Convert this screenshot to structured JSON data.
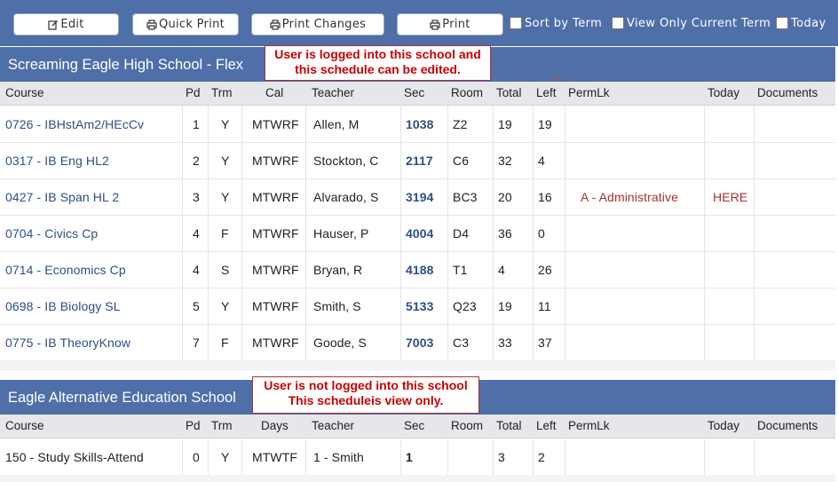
{
  "toolbar": {
    "edit_label": "Edit",
    "quick_print_label": "Quick Print",
    "print_changes_label": "Print Changes",
    "print_label": "Print",
    "sort_by_term_label": "Sort by Term",
    "view_only_current_term_label": "View Only Current Term",
    "today_label": "Today"
  },
  "colors": {
    "header_blue": "#4f6fa8",
    "link_blue": "#2e4f8a",
    "notice_red": "#cc0000",
    "perm_red": "#a83232"
  },
  "schools": [
    {
      "name": "Screaming Eagle High School - Flex",
      "notice_line1": "User is logged into this school and",
      "notice_line2": "this schedule can be edited.",
      "columns": [
        "Course",
        "Pd",
        "Trm",
        "Cal",
        "Teacher",
        "Sec",
        "Room",
        "Total",
        "Left",
        "PermLk",
        "Today",
        "Documents"
      ],
      "rows": [
        {
          "course": "0726 - IBHstAm2/HEcCv",
          "pd": "1",
          "trm": "Y",
          "cal": "MTWRF",
          "teacher": "Allen, M",
          "sec": "1038",
          "room": "Z2",
          "total": "19",
          "left": "19",
          "permlk": "",
          "today": ""
        },
        {
          "course": "0317 - IB Eng HL2",
          "pd": "2",
          "trm": "Y",
          "cal": "MTWRF",
          "teacher": "Stockton, C",
          "sec": "2117",
          "room": "C6",
          "total": "32",
          "left": "4",
          "permlk": "",
          "today": ""
        },
        {
          "course": "0427 - IB Span HL 2",
          "pd": "3",
          "trm": "Y",
          "cal": "MTWRF",
          "teacher": "Alvarado, S",
          "sec": "3194",
          "room": "BC3",
          "total": "20",
          "left": "16",
          "permlk": "A - Administrative",
          "today": "HERE"
        },
        {
          "course": "0704 - Civics Cp",
          "pd": "4",
          "trm": "F",
          "cal": "MTWRF",
          "teacher": "Hauser, P",
          "sec": "4004",
          "room": "D4",
          "total": "36",
          "left": "0",
          "permlk": "",
          "today": ""
        },
        {
          "course": "0714 - Economics Cp",
          "pd": "4",
          "trm": "S",
          "cal": "MTWRF",
          "teacher": "Bryan, R",
          "sec": "4188",
          "room": "T1",
          "total": "4",
          "left": "26",
          "permlk": "",
          "today": ""
        },
        {
          "course": "0698 - IB Biology SL",
          "pd": "5",
          "trm": "Y",
          "cal": "MTWRF",
          "teacher": "Smith, S",
          "sec": "5133",
          "room": "Q23",
          "total": "19",
          "left": "11",
          "permlk": "",
          "today": ""
        },
        {
          "course": "0775 - IB TheoryKnow",
          "pd": "7",
          "trm": "F",
          "cal": "MTWRF",
          "teacher": "Goode, S",
          "sec": "7003",
          "room": "C3",
          "total": "33",
          "left": "37",
          "permlk": "",
          "today": ""
        }
      ]
    },
    {
      "name": "Eagle Alternative Education School",
      "notice_line1": "User is not logged into this school",
      "notice_line2": "This scheduleis view only.",
      "columns": [
        "Course",
        "Pd",
        "Trm",
        "Days",
        "Teacher",
        "Sec",
        "Room",
        "Total",
        "Left",
        "PermLk",
        "Today",
        "Documents"
      ],
      "rows": [
        {
          "course": "150 - Study Skills-Attend",
          "pd": "0",
          "trm": "Y",
          "cal": "MTWTF",
          "teacher": "1 - Smith",
          "sec": "1",
          "room": "",
          "total": "3",
          "left": "2",
          "permlk": "",
          "today": ""
        }
      ]
    }
  ]
}
